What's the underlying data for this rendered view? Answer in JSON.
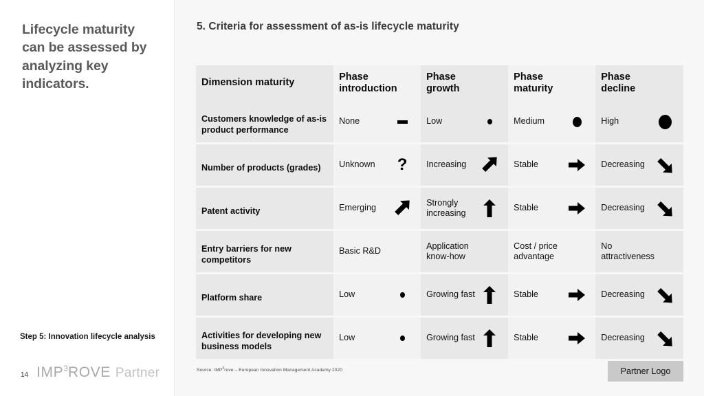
{
  "left_panel": {
    "lead_title": "Lifecycle maturity can be assessed by analyzing key indicators.",
    "step_label": "Step 5: Innovation lifecycle analysis",
    "page_number": "14",
    "logo_main": "IMP",
    "logo_sup": "3",
    "logo_main_rest": "ROVE",
    "logo_partner": "Partner"
  },
  "header": {
    "slide_title": "5. Criteria for assessment of as-is lifecycle maturity"
  },
  "table": {
    "columns": [
      {
        "label": "Dimension maturity"
      },
      {
        "label": "Phase\nintroduction",
        "line1": "Phase",
        "line2": "introduction"
      },
      {
        "label": "Phase\ngrowth",
        "line1": "Phase",
        "line2": "growth"
      },
      {
        "label": "Phase\nmaturity",
        "line1": "Phase",
        "line2": "maturity"
      },
      {
        "label": "Phase\ndecline",
        "line1": "Phase",
        "line2": "decline"
      }
    ],
    "rows": [
      {
        "dimension": "Customers knowledge of as-is product performance",
        "cells": [
          {
            "text": "None",
            "icon": "dash-icon"
          },
          {
            "text": "Low",
            "icon": "small-dot-icon"
          },
          {
            "text": "Medium",
            "icon": "medium-dot-icon"
          },
          {
            "text": "High",
            "icon": "large-dot-icon"
          }
        ]
      },
      {
        "dimension": "Number of products (grades)",
        "cells": [
          {
            "text": "Unknown",
            "icon": "question-mark-icon"
          },
          {
            "text": "Increasing",
            "icon": "arrow-up-right-icon"
          },
          {
            "text": "Stable",
            "icon": "arrow-right-icon"
          },
          {
            "text": "Decreasing",
            "icon": "arrow-down-right-icon"
          }
        ]
      },
      {
        "dimension": "Patent activity",
        "cells": [
          {
            "text": "Emerging",
            "icon": "arrow-up-right-icon"
          },
          {
            "text": "Strongly increasing",
            "icon": "arrow-up-icon"
          },
          {
            "text": "Stable",
            "icon": "arrow-right-icon"
          },
          {
            "text": "Decreasing",
            "icon": "arrow-down-right-icon"
          }
        ]
      },
      {
        "dimension": "Entry barriers for new competitors",
        "cells": [
          {
            "text": "Basic R&D",
            "icon": "none"
          },
          {
            "text": "Application know-how",
            "icon": "none"
          },
          {
            "text": "Cost / price advantage",
            "icon": "none"
          },
          {
            "text": "No attractiveness",
            "icon": "none"
          }
        ]
      },
      {
        "dimension": "Platform share",
        "cells": [
          {
            "text": "Low",
            "icon": "small-dot-icon"
          },
          {
            "text": "Growing fast",
            "icon": "arrow-up-icon"
          },
          {
            "text": "Stable",
            "icon": "arrow-right-icon"
          },
          {
            "text": "Decreasing",
            "icon": "arrow-down-right-icon"
          }
        ]
      },
      {
        "dimension": "Activities for developing new business models",
        "cells": [
          {
            "text": "Low",
            "icon": "small-dot-icon"
          },
          {
            "text": "Growing fast",
            "icon": "arrow-up-icon"
          },
          {
            "text": "Stable",
            "icon": "arrow-right-icon"
          },
          {
            "text": "Decreasing",
            "icon": "arrow-down-right-icon"
          }
        ]
      }
    ]
  },
  "footer": {
    "source_prefix": "Source: IMP",
    "source_sup": "3",
    "source_rest": "rove – European Innovation Management Academy 2020",
    "partner_logo": "Partner Logo"
  },
  "colors": {
    "page_background": "#ffffff",
    "content_background": "#f7f7f7",
    "column_tint_dark": "#e8e8e8",
    "column_tint_light": "#f2f2f2",
    "lead_title_color": "#5a5a5a",
    "title_color": "#3b3b3b",
    "marker_color": "#000000",
    "partner_logo_background": "#c9c9c9"
  }
}
